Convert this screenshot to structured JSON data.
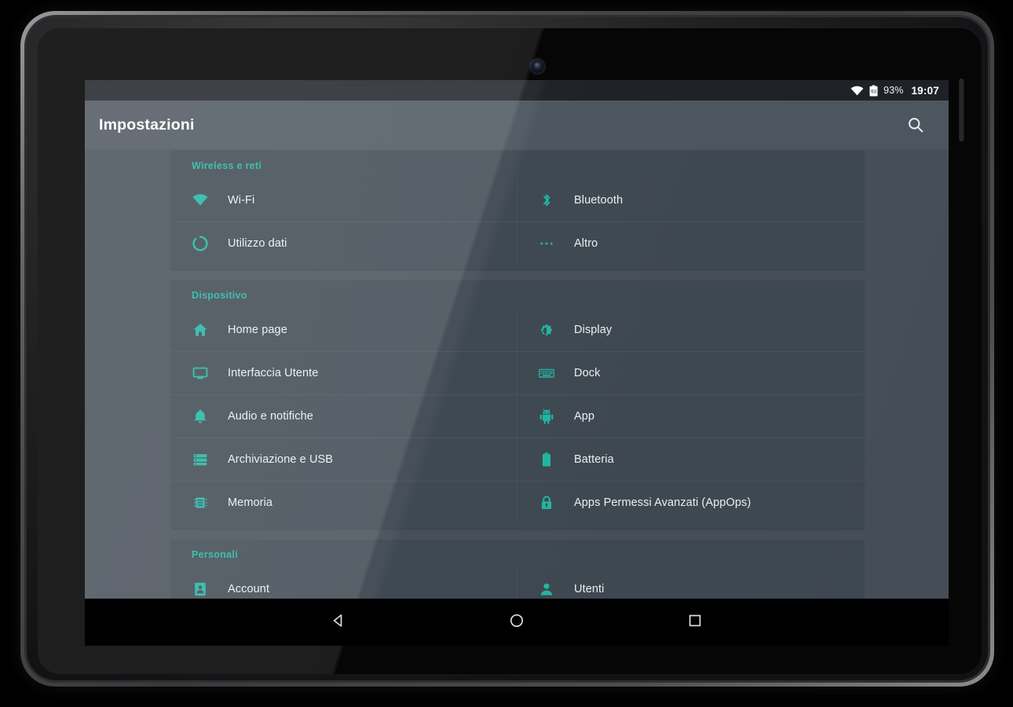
{
  "device": {
    "camera_icon": "front-camera-icon",
    "side_button_icon": "power-button"
  },
  "status_bar": {
    "wifi_icon": "wifi-icon",
    "battery_icon": "battery-icon",
    "battery_level": "93",
    "battery_percent": "93%",
    "clock": "19:07"
  },
  "action_bar": {
    "title": "Impostazioni",
    "search_icon": "search-icon"
  },
  "theme": {
    "accent": "#1fb5a0",
    "card_bg": "#3d4750",
    "page_bg": "#454e57",
    "action_bar_bg": "#4c555e",
    "status_bar_bg": "#1d2126",
    "text_primary": "#eceff1"
  },
  "sections": [
    {
      "header": "Wireless e reti",
      "left_items": [
        {
          "label": "Wi-Fi",
          "icon": "wifi-icon"
        },
        {
          "label": "Utilizzo dati",
          "icon": "data-usage-icon"
        }
      ],
      "right_items": [
        {
          "label": "Bluetooth",
          "icon": "bluetooth-icon"
        },
        {
          "label": "Altro",
          "icon": "more-horizontal-icon"
        }
      ]
    },
    {
      "header": "Dispositivo",
      "left_items": [
        {
          "label": "Home page",
          "icon": "home-icon"
        },
        {
          "label": "Interfaccia Utente",
          "icon": "monitor-icon"
        },
        {
          "label": "Audio e notifiche",
          "icon": "bell-icon"
        },
        {
          "label": "Archiviazione e USB",
          "icon": "storage-icon"
        },
        {
          "label": "Memoria",
          "icon": "memory-chip-icon"
        }
      ],
      "right_items": [
        {
          "label": "Display",
          "icon": "brightness-icon"
        },
        {
          "label": "Dock",
          "icon": "keyboard-icon"
        },
        {
          "label": "App",
          "icon": "android-robot-icon"
        },
        {
          "label": "Batteria",
          "icon": "battery-icon"
        },
        {
          "label": "Apps Permessi Avanzati (AppOps)",
          "icon": "lock-icon"
        }
      ]
    },
    {
      "header": "Personali",
      "left_items": [
        {
          "label": "Account",
          "icon": "account-card-icon"
        }
      ],
      "right_items": [
        {
          "label": "Utenti",
          "icon": "person-icon"
        }
      ]
    }
  ],
  "nav_bar": {
    "back_icon": "back-triangle-icon",
    "home_icon": "home-circle-icon",
    "recents_icon": "recents-square-icon"
  }
}
